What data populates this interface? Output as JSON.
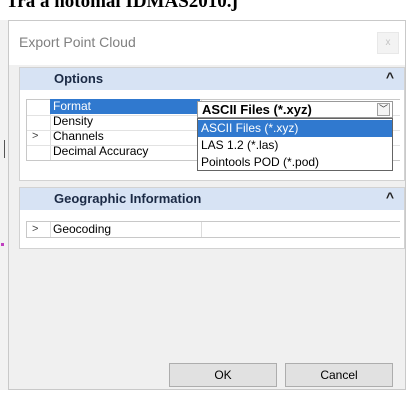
{
  "background": {
    "text": "Tra a notomal IDMAS2010.j"
  },
  "dialog": {
    "title": "Export Point Cloud",
    "close_label": "x"
  },
  "options": {
    "title": "Options",
    "collapse_icon": "chevron-up-icon",
    "properties": [
      {
        "name": "Format",
        "selected": true
      },
      {
        "name": "Density",
        "selected": false
      },
      {
        "name": "Channels",
        "selected": false,
        "expandable": true
      },
      {
        "name": "Decimal Accuracy",
        "selected": false
      }
    ],
    "format_value": "ASCII Files (*.xyz)",
    "expand_glyph": ">",
    "dropdown_glyph": "﹀",
    "format_options": [
      {
        "label": "ASCII Files (*.xyz)",
        "selected": true
      },
      {
        "label": "LAS 1.2 (*.las)",
        "selected": false
      },
      {
        "label": "Pointools POD (*.pod)",
        "selected": false
      }
    ]
  },
  "geographic": {
    "title": "Geographic Information",
    "collapse_icon": "chevron-up-icon",
    "expand_glyph": ">",
    "rows": [
      {
        "name": "Geocoding"
      }
    ]
  },
  "footer": {
    "ok_label": "OK",
    "cancel_label": "Cancel"
  }
}
